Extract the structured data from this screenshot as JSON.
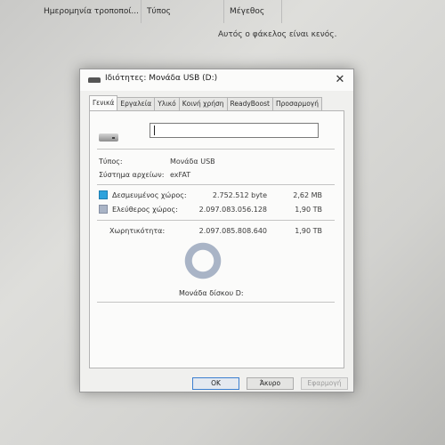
{
  "explorer": {
    "columns": [
      "Ημερομηνία τροποποί...",
      "Τύπος",
      "Μέγεθος"
    ],
    "empty_message": "Αυτός ο φάκελος είναι κενός."
  },
  "dialog": {
    "title": "Ιδιότητες: Μονάδα USB (D:)",
    "close_glyph": "✕",
    "tabs": [
      "Γενικά",
      "Εργαλεία",
      "Υλικό",
      "Κοινή χρήση",
      "ReadyBoost",
      "Προσαρμογή"
    ],
    "active_tab": "Γενικά",
    "name_value": "",
    "type_label": "Τύπος:",
    "type_value": "Μονάδα USB",
    "fs_label": "Σύστημα αρχείων:",
    "fs_value": "exFAT",
    "used_label": "Δεσμευμένος χώρος:",
    "used_bytes": "2.752.512 byte",
    "used_size": "2,62 MB",
    "used_color": "#2da2dc",
    "free_label": "Ελεύθερος χώρος:",
    "free_bytes": "2.097.083.056.128",
    "free_size": "1,90 TB",
    "free_color": "#a9b4c6",
    "capacity_label": "Χωρητικότητα:",
    "capacity_bytes": "2.097.085.808.640",
    "capacity_size": "1,90 TB",
    "disk_label": "Μονάδα δίσκου D:",
    "buttons": {
      "ok": "OK",
      "cancel": "Άκυρο",
      "apply": "Εφαρμογή"
    }
  }
}
